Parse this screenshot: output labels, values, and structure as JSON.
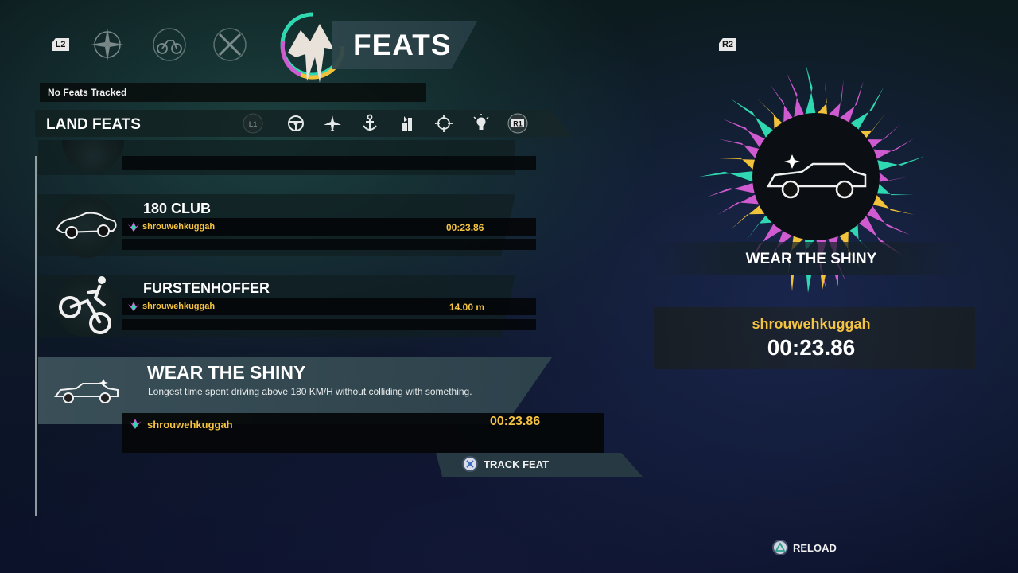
{
  "header": {
    "left_bumper": "L2",
    "right_bumper": "R2",
    "title": "FEATS",
    "nav_icons": [
      "compass-icon",
      "bicycle-icon",
      "crossed-weapons-icon"
    ]
  },
  "tracked": {
    "text": "No Feats Tracked"
  },
  "category": {
    "title": "LAND FEATS",
    "tab_left": "L1",
    "tab_right": "R1",
    "icons": [
      "steering-wheel-icon",
      "plane-icon",
      "anchor-icon",
      "hunting-icon",
      "crosshair-icon",
      "lightbulb-icon"
    ]
  },
  "feats": [
    {
      "title": "180 CLUB",
      "player": "shrouwehkuggah",
      "score": "00:23.86"
    },
    {
      "title": "FURSTENHOFFER",
      "player": "shrouwehkuggah",
      "score": "14.00 m"
    }
  ],
  "selected": {
    "title": "WEAR THE SHINY",
    "description": "Longest time spent driving above 180 KM/H without colliding with something.",
    "player": "shrouwehkuggah",
    "score": "00:23.86"
  },
  "actions": {
    "track": "TRACK FEAT",
    "reload": "RELOAD"
  },
  "detail": {
    "title": "WEAR THE SHINY",
    "player": "shrouwehkuggah",
    "score": "00:23.86"
  },
  "colors": {
    "gold": "#f5c342",
    "burst_pink": "#d05ad0",
    "burst_teal": "#2fd8b0",
    "burst_yellow": "#f2c23a"
  }
}
